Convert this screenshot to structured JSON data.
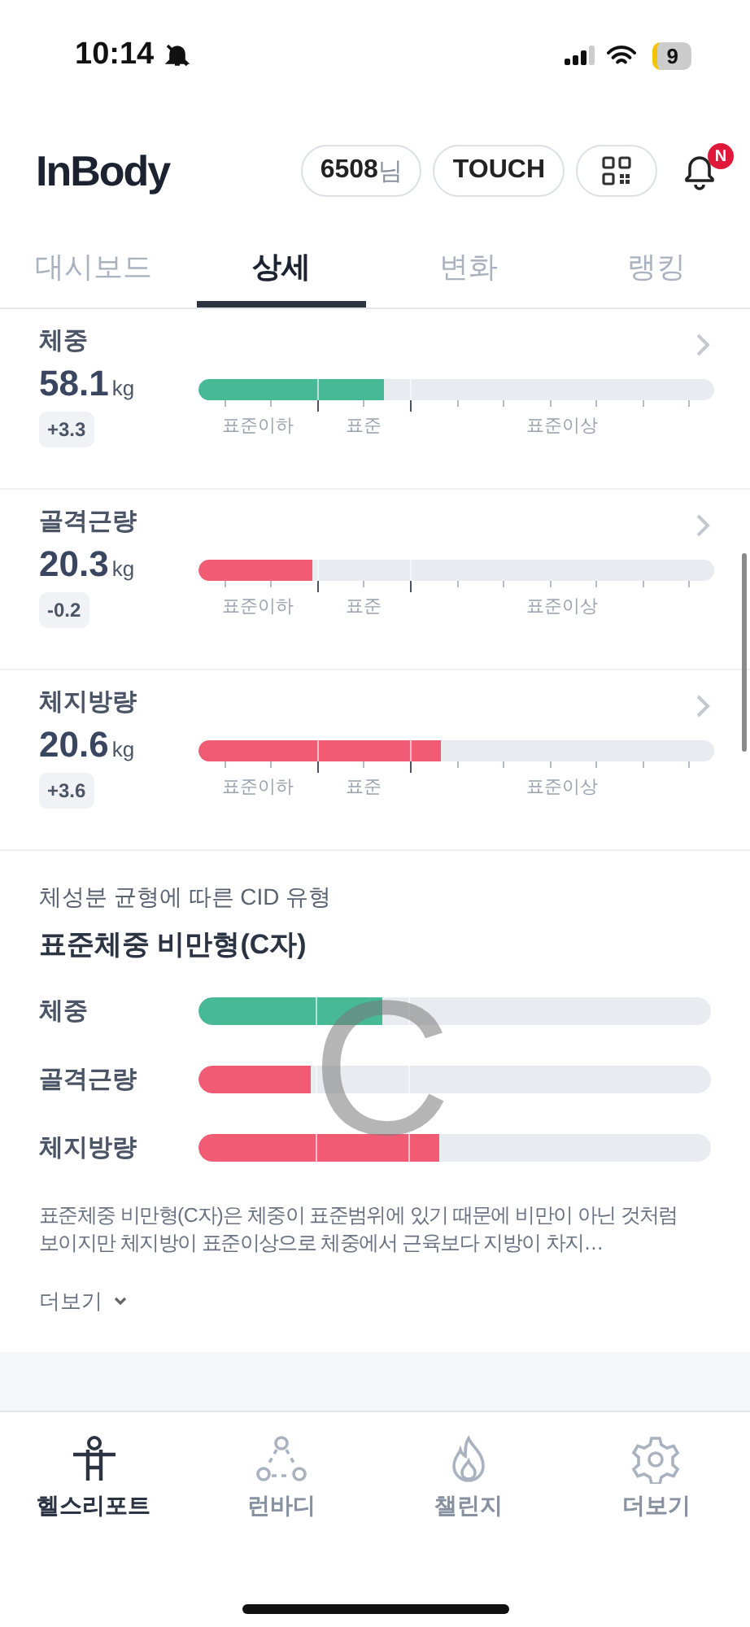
{
  "status_bar": {
    "time": "10:14",
    "battery": "9"
  },
  "header": {
    "logo": "InBody",
    "user": "6508",
    "user_suffix": "님",
    "touch": "TOUCH",
    "notification_badge": "N"
  },
  "tabs": [
    {
      "label": "대시보드",
      "selected": false
    },
    {
      "label": "상세",
      "selected": true
    },
    {
      "label": "변화",
      "selected": false
    },
    {
      "label": "랭킹",
      "selected": false
    }
  ],
  "metrics": [
    {
      "name": "체중",
      "value": "58.1",
      "unit": "kg",
      "change": "+3.3",
      "level": 0.36,
      "color": "#47b994",
      "scale_labels": [
        "표준이하",
        "표준",
        "표준이상"
      ]
    },
    {
      "name": "골격근량",
      "value": "20.3",
      "unit": "kg",
      "change": "-0.2",
      "level": 0.22,
      "color": "#f15b74",
      "scale_labels": [
        "표준이하",
        "표준",
        "표준이상"
      ]
    },
    {
      "name": "체지방량",
      "value": "20.6",
      "unit": "kg",
      "change": "+3.6",
      "level": 0.47,
      "color": "#f15b74",
      "scale_labels": [
        "표준이하",
        "표준",
        "표준이상"
      ]
    }
  ],
  "cid": {
    "subtitle": "체성분 균형에 따른 CID 유형",
    "title": "표준체중 비만형(C자)",
    "overlay_letter": "C",
    "bars": [
      {
        "name": "체중",
        "level": 0.36,
        "color": "#47b994"
      },
      {
        "name": "골격근량",
        "level": 0.22,
        "color": "#f15b74"
      },
      {
        "name": "체지방량",
        "level": 0.47,
        "color": "#f15b74"
      }
    ],
    "description": "표준체중 비만형(C자)은 체중이 표준범위에 있기 때문에 비만이 아닌 것처럼 보이지만 체지방이 표준이상으로 체중에서 근육보다 지방이 차지…",
    "more": "더보기"
  },
  "bottom_nav": [
    {
      "label": "헬스리포트",
      "selected": true
    },
    {
      "label": "런바디",
      "selected": false
    },
    {
      "label": "챌린지",
      "selected": false
    },
    {
      "label": "더보기",
      "selected": false
    }
  ]
}
